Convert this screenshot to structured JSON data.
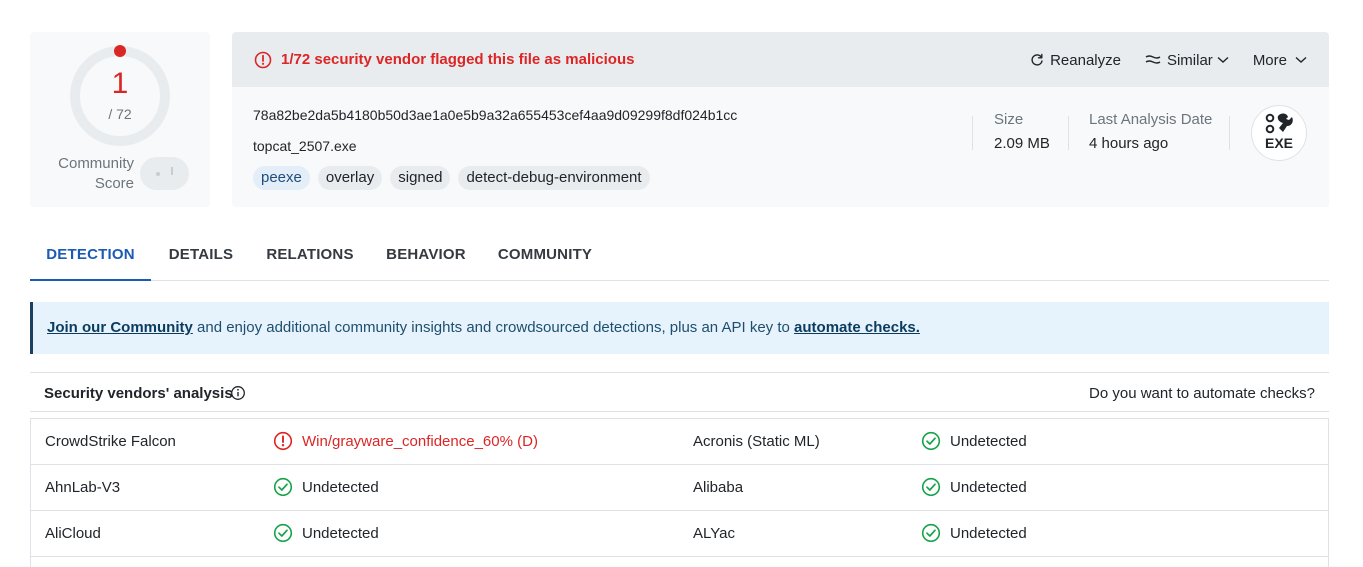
{
  "score": {
    "positives": "1",
    "total": "/ 72",
    "community_label": "Community Score"
  },
  "alert": {
    "text": "1/72 security vendor flagged this file as malicious"
  },
  "actions": {
    "reanalyze": "Reanalyze",
    "similar": "Similar",
    "more": "More"
  },
  "file": {
    "hash": "78a82be2da5b4180b50d3ae1a0e5b9a32a655453cef4aa9d09299f8df024b1cc",
    "name": "topcat_2507.exe",
    "tags": [
      "peexe",
      "overlay",
      "signed",
      "detect-debug-environment"
    ],
    "size_label": "Size",
    "size_value": "2.09 MB",
    "date_label": "Last Analysis Date",
    "date_value": "4 hours ago",
    "type_badge": "EXE"
  },
  "tabs": [
    "DETECTION",
    "DETAILS",
    "RELATIONS",
    "BEHAVIOR",
    "COMMUNITY"
  ],
  "banner": {
    "link1": "Join our Community",
    "middle": " and enjoy additional community insights and crowdsourced detections, plus an API key to ",
    "link2": "automate checks."
  },
  "section": {
    "title": "Security vendors' analysis",
    "right": "Do you want to automate checks?"
  },
  "vendors": [
    {
      "left_name": "CrowdStrike Falcon",
      "left_result": "Win/grayware_confidence_60% (D)",
      "right_name": "Acronis (Static ML)",
      "right_result": "Undetected"
    },
    {
      "left_name": "AhnLab-V3",
      "left_result": "Undetected",
      "right_name": "Alibaba",
      "right_result": "Undetected"
    },
    {
      "left_name": "AliCloud",
      "left_result": "Undetected",
      "right_name": "ALYac",
      "right_result": "Undetected"
    }
  ],
  "colors": {
    "malicious": "#dc2626",
    "clean": "#16a34a",
    "accent": "#1b5bb5"
  }
}
